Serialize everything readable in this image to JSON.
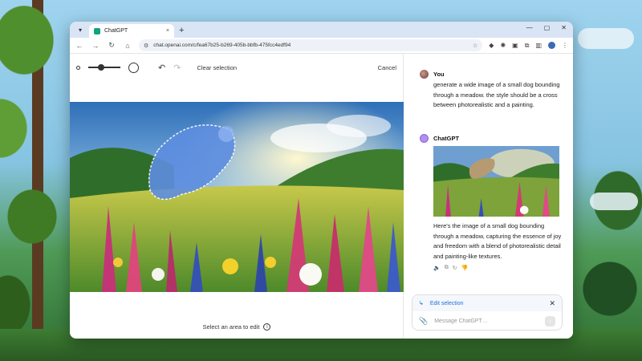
{
  "browser": {
    "tab_title": "ChatGPT",
    "tab_close": "×",
    "new_tab": "+",
    "url": "chat.openai.com/c/fea67b25-b269-405b-bbfb-475fcc4edf94",
    "window_controls": [
      "—",
      "▢",
      "✕"
    ],
    "nav": {
      "back": "←",
      "forward": "→",
      "reload": "↻",
      "home": "⌂"
    }
  },
  "editor": {
    "undo": "↶",
    "redo": "↷",
    "clear_selection": "Clear selection",
    "cancel": "Cancel",
    "hint": "Select an area to edit",
    "info": "i"
  },
  "chat": {
    "user": {
      "name": "You",
      "text": "generate a wide image of a small dog bounding through a meadow. the style should be a cross between photorealistic and a painting."
    },
    "assistant": {
      "name": "ChatGPT",
      "text": "Here's the image of a small dog bounding through a meadow, capturing the essence of joy and freedom with a blend of photorealistic detail and painting-like textures."
    },
    "composer": {
      "edit_selection": "Edit selection",
      "placeholder": "Message ChatGPT…",
      "close": "✕",
      "send": "↑"
    }
  },
  "colors": {
    "accent": "#1e6fd9",
    "chatgpt_green": "#10a37f"
  }
}
